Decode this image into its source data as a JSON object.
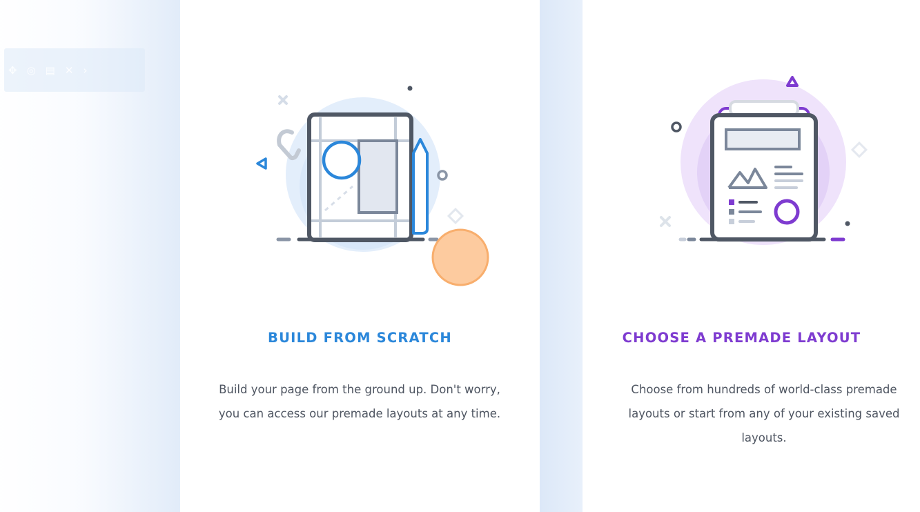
{
  "cards": [
    {
      "title": "BUILD FROM SCRATCH",
      "description": "Build your page from the ground up. Don't worry, you can access our premade layouts at any time.",
      "accent_color": "#2b87da"
    },
    {
      "title": "CHOOSE A PREMADE LAYOUT",
      "description": "Choose from hundreds of world-class premade layouts or start from any of your existing saved layouts.",
      "accent_color": "#7e3bd0"
    }
  ],
  "background_toolbar": {
    "icons": [
      "move-icon",
      "lock-icon",
      "tablet-icon",
      "close-icon",
      "chevron-icon"
    ]
  },
  "colors": {
    "blue": "#2b87da",
    "purple": "#7e3bd0",
    "orange": "#fbc697",
    "dark_gray": "#4f5764",
    "text": "#4e5561"
  }
}
